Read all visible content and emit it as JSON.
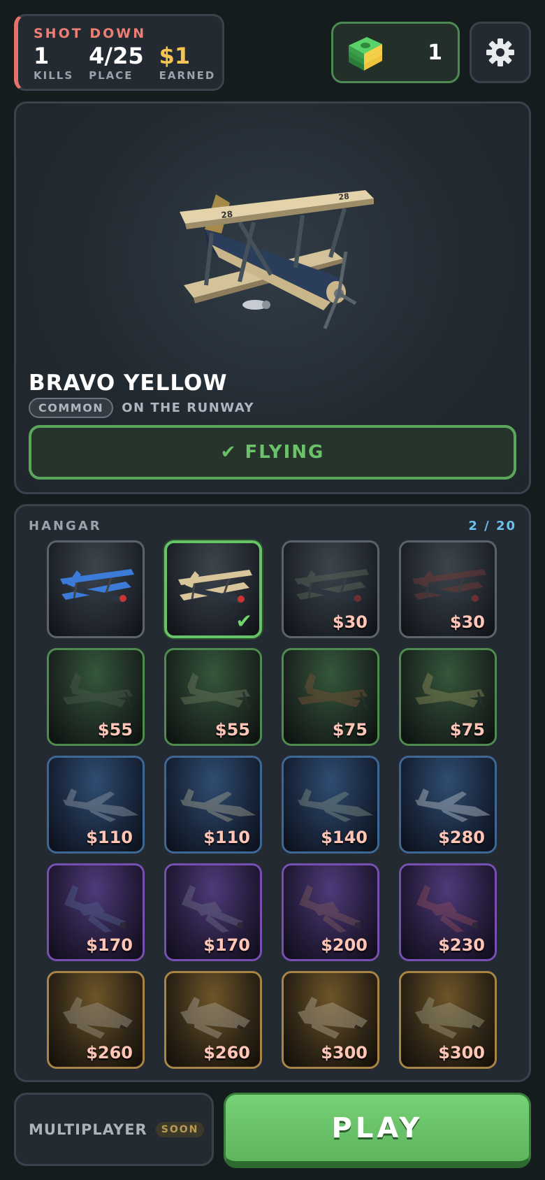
{
  "stats": {
    "title": "SHOT DOWN",
    "kills_value": "1",
    "kills_label": "KILLS",
    "place_value": "4/25",
    "place_label": "PLACE",
    "earned_value": "$1",
    "earned_label": "EARNED"
  },
  "cash": {
    "value": "1",
    "icon": "cash-stack-icon"
  },
  "settings": {
    "icon": "gear-icon"
  },
  "preview": {
    "name": "BRAVO YELLOW",
    "rarity": "COMMON",
    "status": "ON THE RUNWAY",
    "flying_label": "✔ FLYING"
  },
  "hangar": {
    "title": "HANGAR",
    "count": "2 / 20",
    "items": [
      {
        "price": "",
        "tier": "grey",
        "kind": "biplane",
        "color": "#3c7bd8",
        "owned": true,
        "selected": false
      },
      {
        "price": "",
        "tier": "grey",
        "kind": "biplane",
        "color": "#d8c59a",
        "owned": true,
        "selected": true
      },
      {
        "price": "$30",
        "tier": "grey",
        "kind": "biplane",
        "color": "#5c6a5a",
        "owned": false,
        "selected": false
      },
      {
        "price": "$30",
        "tier": "grey",
        "kind": "biplane",
        "color": "#7a3b35",
        "owned": false,
        "selected": false
      },
      {
        "price": "$55",
        "tier": "green",
        "kind": "prop",
        "color": "#4a5a4c",
        "owned": false,
        "selected": false
      },
      {
        "price": "$55",
        "tier": "green",
        "kind": "prop",
        "color": "#6b7a5e",
        "owned": false,
        "selected": false
      },
      {
        "price": "$75",
        "tier": "green",
        "kind": "prop",
        "color": "#7a5138",
        "owned": false,
        "selected": false
      },
      {
        "price": "$75",
        "tier": "green",
        "kind": "prop",
        "color": "#8a8a58",
        "owned": false,
        "selected": false
      },
      {
        "price": "$110",
        "tier": "blue",
        "kind": "jet",
        "color": "#8f9aa6",
        "owned": false,
        "selected": false
      },
      {
        "price": "$110",
        "tier": "blue",
        "kind": "jet",
        "color": "#a3a08e",
        "owned": false,
        "selected": false
      },
      {
        "price": "$140",
        "tier": "blue",
        "kind": "jet",
        "color": "#7f8e86",
        "owned": false,
        "selected": false
      },
      {
        "price": "$280",
        "tier": "blue",
        "kind": "jet",
        "color": "#b8c0c8",
        "owned": false,
        "selected": false
      },
      {
        "price": "$170",
        "tier": "purple",
        "kind": "fighter",
        "color": "#4f5f8a",
        "owned": false,
        "selected": false
      },
      {
        "price": "$170",
        "tier": "purple",
        "kind": "fighter",
        "color": "#6a6c85",
        "owned": false,
        "selected": false
      },
      {
        "price": "$200",
        "tier": "purple",
        "kind": "fighter",
        "color": "#7a5a58",
        "owned": false,
        "selected": false
      },
      {
        "price": "$230",
        "tier": "purple",
        "kind": "fighter",
        "color": "#8a4a58",
        "owned": false,
        "selected": false
      },
      {
        "price": "$260",
        "tier": "gold",
        "kind": "stealth",
        "color": "#9a958a",
        "owned": false,
        "selected": false
      },
      {
        "price": "$260",
        "tier": "gold",
        "kind": "stealth",
        "color": "#a8a295",
        "owned": false,
        "selected": false
      },
      {
        "price": "$300",
        "tier": "gold",
        "kind": "stealth",
        "color": "#b0a690",
        "owned": false,
        "selected": false
      },
      {
        "price": "$300",
        "tier": "gold",
        "kind": "stealth",
        "color": "#9a9a80",
        "owned": false,
        "selected": false
      }
    ]
  },
  "bottom": {
    "multiplayer_label": "MULTIPLAYER",
    "soon_label": "SOON",
    "play_label": "PLAY"
  },
  "colors": {
    "accent_green": "#66c466",
    "stats_red": "#ef7e72",
    "gold": "#f6c452",
    "count_blue": "#6ec1ee"
  }
}
